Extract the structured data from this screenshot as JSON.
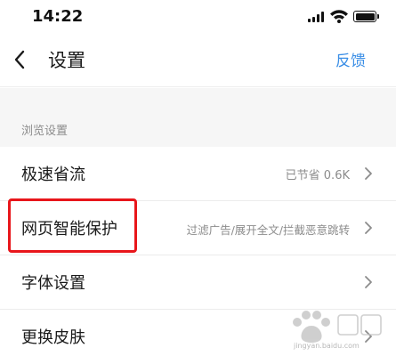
{
  "status_bar": {
    "time": "14:22"
  },
  "nav": {
    "back_icon": "chevron-left-icon",
    "title": "设置",
    "feedback": "反馈"
  },
  "section": {
    "header": "浏览设置"
  },
  "rows": [
    {
      "label": "极速省流",
      "value": "已节省 0.6K"
    },
    {
      "label": "网页智能保护",
      "value": "过滤广告/展开全文/拦截恶意跳转"
    },
    {
      "label": "字体设置",
      "value": ""
    },
    {
      "label": "更换皮肤",
      "value": ""
    }
  ],
  "colors": {
    "accent": "#3a8ee6",
    "highlight": "#e8161b",
    "section_bg": "#f6f6f6"
  },
  "watermark": {
    "url": "jingyan.baidu.com"
  }
}
